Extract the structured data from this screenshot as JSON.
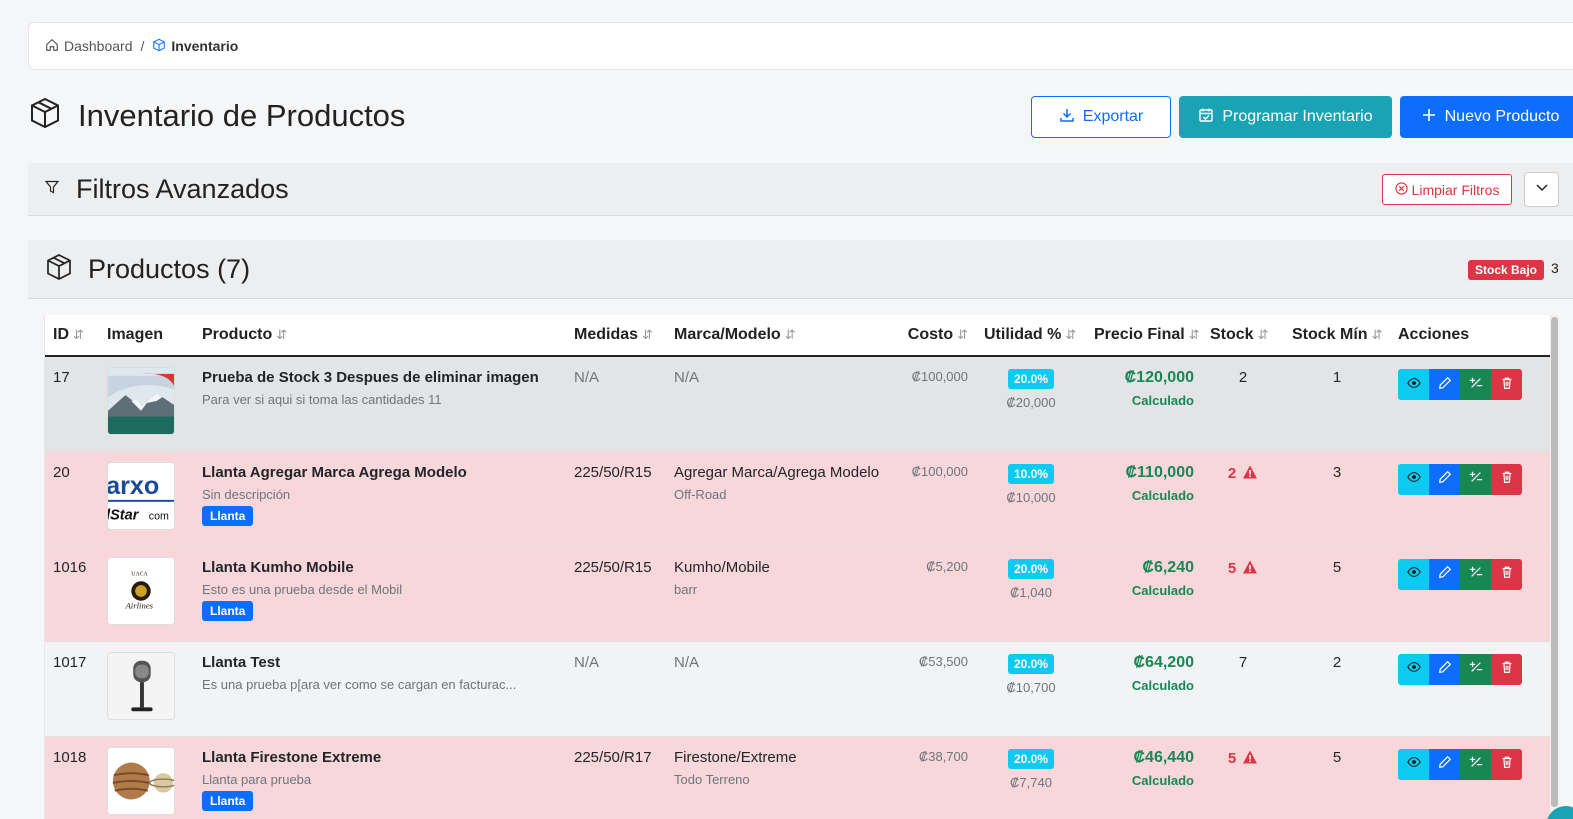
{
  "breadcrumb": {
    "home": "Dashboard",
    "separator": "/",
    "current": "Inventario"
  },
  "page": {
    "title": "Inventario de Productos"
  },
  "toolbar": {
    "export_label": "Exportar",
    "schedule_label": "Programar Inventario",
    "new_label": "Nuevo Producto"
  },
  "filters": {
    "title": "Filtros Avanzados",
    "clear_label": "Limpiar Filtros"
  },
  "products": {
    "title": "Productos (7)",
    "stock_badge": "Stock Bajo",
    "stock_count": "3"
  },
  "table": {
    "headers": {
      "id": "ID",
      "image": "Imagen",
      "product": "Producto",
      "size": "Medidas",
      "brand": "Marca/Modelo",
      "cost": "Costo",
      "util": "Utilidad %",
      "price": "Precio Final",
      "stock": "Stock",
      "stock_min": "Stock Mín",
      "actions": "Acciones"
    },
    "rows": [
      {
        "id": "17",
        "name": "Prueba de Stock 3 Despues de eliminar imagen",
        "desc": "Para ver si aqui si toma las cantidades 11",
        "tag": "",
        "size": "N/A",
        "brand": "N/A",
        "model_sub": "",
        "cost": "₡100,000",
        "util": "20.0%",
        "util_sub": "₡20,000",
        "price": "₡120,000",
        "price_sub": "Calculado",
        "stock": "2",
        "stock_low": false,
        "stock_min": "1",
        "image": "mountain"
      },
      {
        "id": "20",
        "name": "Llanta Agregar Marca Agrega Modelo",
        "desc": "Sin descripción",
        "tag": "Llanta",
        "size": "225/50/R15",
        "brand": "Agregar Marca/Agrega Modelo",
        "model_sub": "Off-Road",
        "cost": "₡100,000",
        "util": "10.0%",
        "util_sub": "₡10,000",
        "price": "₡110,000",
        "price_sub": "Calculado",
        "stock": "2",
        "stock_low": true,
        "stock_min": "3",
        "image": "logo-text"
      },
      {
        "id": "1016",
        "name": "Llanta Kumho Mobile",
        "desc": "Esto es una prueba desde el Mobil",
        "tag": "Llanta",
        "size": "225/50/R15",
        "brand": "Kumho/Mobile",
        "model_sub": "barr",
        "cost": "₡5,200",
        "util": "20.0%",
        "util_sub": "₡1,040",
        "price": "₡6,240",
        "price_sub": "Calculado",
        "stock": "5",
        "stock_low": true,
        "stock_min": "5",
        "image": "airline-logo"
      },
      {
        "id": "1017",
        "name": "Llanta Test",
        "desc": "Es una prueba p[ara ver como se cargan en facturac...",
        "tag": "",
        "size": "N/A",
        "brand": "N/A",
        "model_sub": "",
        "cost": "₡53,500",
        "util": "20.0%",
        "util_sub": "₡10,700",
        "price": "₡64,200",
        "price_sub": "Calculado",
        "stock": "7",
        "stock_low": false,
        "stock_min": "2",
        "image": "microphone"
      },
      {
        "id": "1018",
        "name": "Llanta Firestone Extreme",
        "desc": "Llanta para prueba",
        "tag": "Llanta",
        "size": "225/50/R17",
        "brand": "Firestone/Extreme",
        "model_sub": "Todo Terreno",
        "cost": "₡38,700",
        "util": "20.0%",
        "util_sub": "₡7,740",
        "price": "₡46,440",
        "price_sub": "Calculado",
        "stock": "5",
        "stock_low": true,
        "stock_min": "5",
        "image": "planets"
      }
    ]
  },
  "colors": {
    "primary": "#0d6efd",
    "info": "#0dcaf0",
    "success": "#198754",
    "danger": "#dc3545",
    "teal": "#1aa3b5",
    "row_low_stock": "#f8d7da"
  }
}
